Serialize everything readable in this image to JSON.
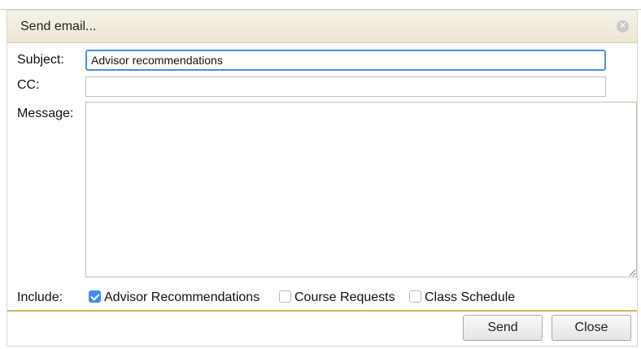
{
  "dialog": {
    "title": "Send email...",
    "close_icon": "close-circle-icon"
  },
  "form": {
    "subject_label": "Subject:",
    "subject_value": "Advisor recommendations",
    "cc_label": "CC:",
    "cc_value": "",
    "message_label": "Message:",
    "message_value": ""
  },
  "include": {
    "label": "Include:",
    "options": [
      {
        "label": "Advisor Recommendations",
        "checked": true
      },
      {
        "label": "Course Requests",
        "checked": false
      },
      {
        "label": "Class Schedule",
        "checked": false
      }
    ]
  },
  "buttons": {
    "send": "Send",
    "close": "Close"
  },
  "colors": {
    "focus_border": "#4a90e2",
    "checkbox_checked": "#3f8ef0",
    "divider": "#d9b25a",
    "titlebar": "#efe9d8"
  }
}
